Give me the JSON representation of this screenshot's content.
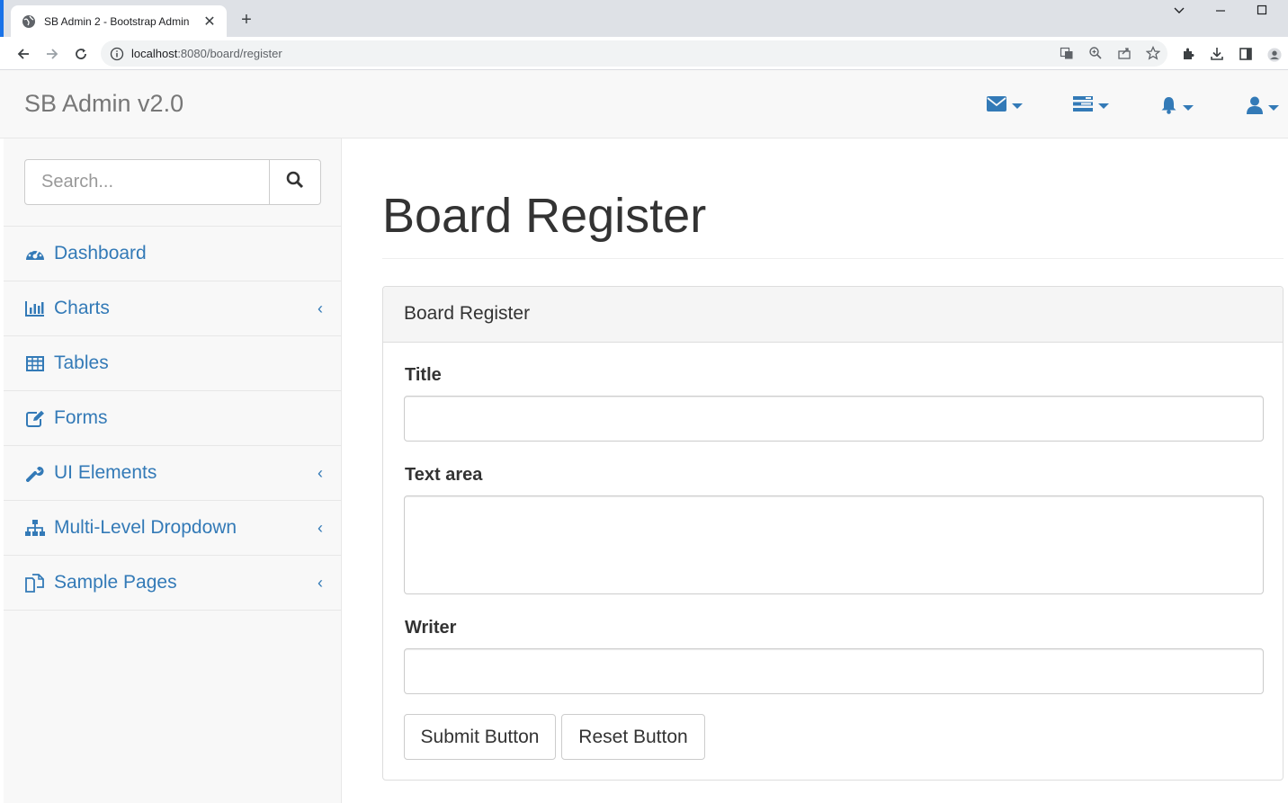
{
  "browser": {
    "tab_title": "SB Admin 2 - Bootstrap Admin",
    "tab_close": "✕",
    "new_tab": "+",
    "url_host": "localhost",
    "url_rest": ":8080/board/register"
  },
  "navbar": {
    "brand": "SB Admin v2.0",
    "items": [
      {
        "icon": "envelope-icon"
      },
      {
        "icon": "tasks-icon"
      },
      {
        "icon": "bell-icon"
      },
      {
        "icon": "user-icon"
      }
    ],
    "accent": "#337ab7"
  },
  "sidebar": {
    "search_placeholder": "Search...",
    "items": [
      {
        "label": "Dashboard",
        "icon": "dashboard-icon",
        "has_arrow": false
      },
      {
        "label": "Charts",
        "icon": "bar-chart-icon",
        "has_arrow": true
      },
      {
        "label": "Tables",
        "icon": "table-icon",
        "has_arrow": false
      },
      {
        "label": "Forms",
        "icon": "edit-icon",
        "has_arrow": false
      },
      {
        "label": "UI Elements",
        "icon": "wrench-icon",
        "has_arrow": true
      },
      {
        "label": "Multi-Level Dropdown",
        "icon": "sitemap-icon",
        "has_arrow": true
      },
      {
        "label": "Sample Pages",
        "icon": "files-icon",
        "has_arrow": true
      }
    ],
    "arrow": "‹"
  },
  "main": {
    "page_title": "Board Register",
    "panel_heading": "Board Register",
    "form": {
      "title_label": "Title",
      "title_value": "",
      "textarea_label": "Text area",
      "textarea_value": "",
      "writer_label": "Writer",
      "writer_value": "",
      "submit_label": "Submit Button",
      "reset_label": "Reset Button"
    }
  }
}
